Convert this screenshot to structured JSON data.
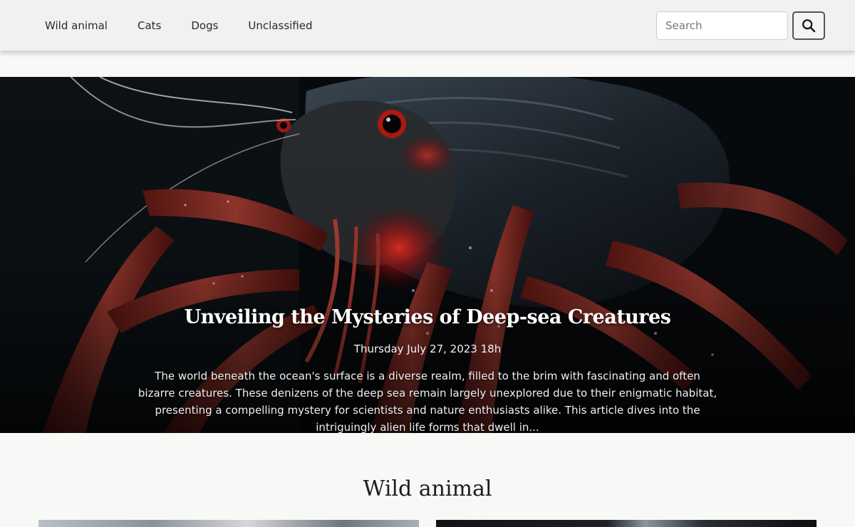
{
  "nav": {
    "items": [
      {
        "label": "Wild animal"
      },
      {
        "label": "Cats"
      },
      {
        "label": "Dogs"
      },
      {
        "label": "Unclassified"
      }
    ],
    "search": {
      "placeholder": "Search",
      "value": ""
    },
    "search_button_icon": "search-icon"
  },
  "hero": {
    "title": "Unveiling the Mysteries of Deep-sea Creatures",
    "date": "Thursday July 27, 2023 18h",
    "excerpt": "The world beneath the ocean's surface is a diverse realm, filled to the brim with fascinating and often bizarre creatures. These denizens of the deep sea remain largely unexplored due to their enigmatic habitat, presenting a compelling mystery for scientists and nature enthusiasts alike. This article dives into the intriguingly alien life forms that dwell in..."
  },
  "section": {
    "title": "Wild animal"
  },
  "colors": {
    "nav_bg": "#f1f1ef",
    "page_bg": "#f8f8f7",
    "hero_text": "#ffffff"
  }
}
